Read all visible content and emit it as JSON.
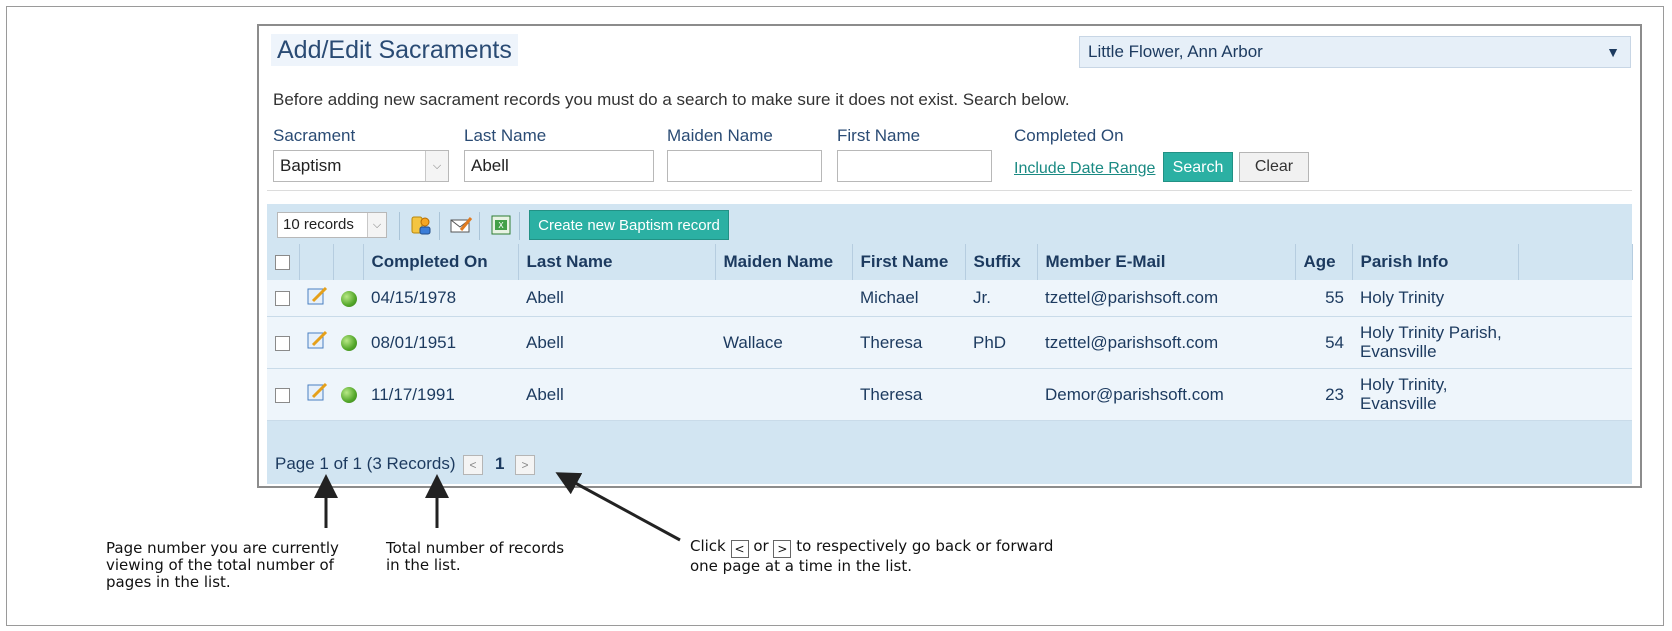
{
  "header": {
    "title": "Add/Edit Sacraments",
    "parish_selected": "Little Flower, Ann Arbor"
  },
  "instructions": "Before adding new sacrament records you must do a search to make sure it does not exist. Search below.",
  "search": {
    "sacrament_label": "Sacrament",
    "sacrament_value": "Baptism",
    "last_name_label": "Last Name",
    "last_name_value": "Abell",
    "maiden_name_label": "Maiden Name",
    "maiden_name_value": "",
    "first_name_label": "First Name",
    "first_name_value": "",
    "completed_on_label": "Completed On",
    "include_date_range": "Include Date Range",
    "search_button": "Search",
    "clear_button": "Clear"
  },
  "toolbar": {
    "records_per_page": "10 records",
    "create_button": "Create new Baptism record",
    "icons": [
      "people-icon",
      "email-icon",
      "excel-export-icon"
    ]
  },
  "table": {
    "columns": [
      "Completed On",
      "Last Name",
      "Maiden Name",
      "First Name",
      "Suffix",
      "Member E-Mail",
      "Age",
      "Parish Info"
    ],
    "rows": [
      {
        "completed_on": "04/15/1978",
        "last_name": "Abell",
        "maiden_name": "",
        "first_name": "Michael",
        "suffix": "Jr.",
        "email": "tzettel@parishsoft.com",
        "age": "55",
        "parish_line1": "Holy Trinity",
        "parish_line2": ""
      },
      {
        "completed_on": "08/01/1951",
        "last_name": "Abell",
        "maiden_name": "Wallace",
        "first_name": "Theresa",
        "suffix": "PhD",
        "email": "tzettel@parishsoft.com",
        "age": "54",
        "parish_line1": "Holy Trinity Parish,",
        "parish_line2": "Evansville"
      },
      {
        "completed_on": "11/17/1991",
        "last_name": "Abell",
        "maiden_name": "",
        "first_name": "Theresa",
        "suffix": "",
        "email": "Demor@parishsoft.com",
        "age": "23",
        "parish_line1": "Holy Trinity,",
        "parish_line2": "Evansville"
      }
    ]
  },
  "pager": {
    "text": "Page 1 of 1 (3 Records)",
    "prev": "<",
    "current": "1",
    "next": ">"
  },
  "callouts": {
    "page_number": {
      "line1": "Page number you are currently",
      "line2": "viewing of the total number of",
      "line3": "pages in the list."
    },
    "total_records": {
      "line1": "Total number of records",
      "line2": "in the list."
    },
    "navigation": {
      "click": "Click",
      "prev_glyph": "<",
      "or": "or",
      "next_glyph": ">",
      "line1_rest": "to respectively go back or forward",
      "line2": "one page at a time in the list."
    }
  },
  "colors": {
    "accent": "#2bb0a3",
    "title_text": "#2a4b74",
    "grid_bg": "#d2e5f2",
    "row_bg": "#eef5fb"
  }
}
